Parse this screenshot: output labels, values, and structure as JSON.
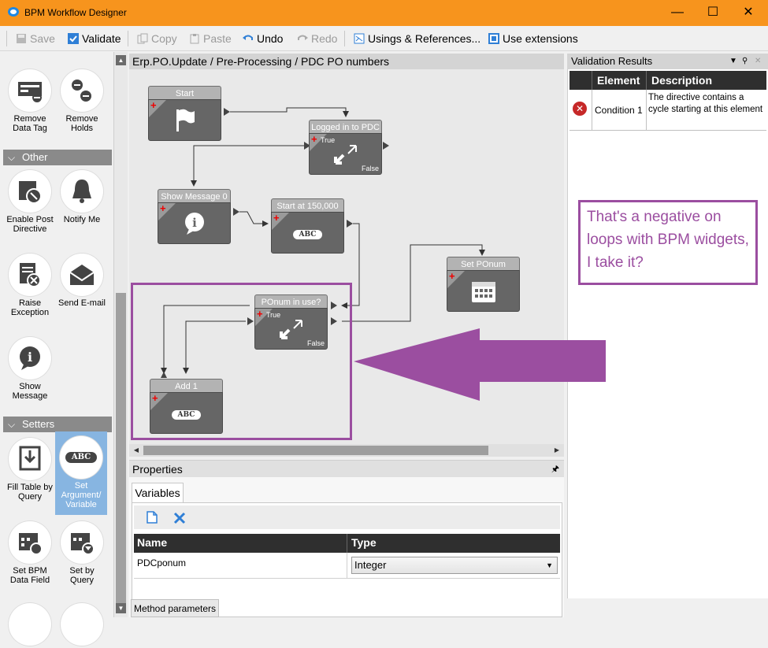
{
  "window": {
    "title": "BPM Workflow Designer"
  },
  "toolbar": {
    "save": "Save",
    "validate": "Validate",
    "copy": "Copy",
    "paste": "Paste",
    "undo": "Undo",
    "redo": "Redo",
    "usings": "Usings & References...",
    "extensions": "Use extensions"
  },
  "toolbox": {
    "top_items": [
      "Remove Data Tag",
      "Remove Holds"
    ],
    "group_other": "Other",
    "other_items": [
      "Enable Post Directive",
      "Notify Me",
      "Raise Exception",
      "Send E-mail",
      "Show Message"
    ],
    "group_setters": "Setters",
    "setter_items": [
      "Fill Table by Query",
      "Set Argument/ Variable",
      "Set BPM Data Field",
      "Set by Query"
    ]
  },
  "canvas": {
    "breadcrumb": "Erp.PO.Update / Pre-Processing / PDC PO numbers",
    "nodes": {
      "start": "Start",
      "logged_in": "Logged in to PDC",
      "show_message": "Show Message 0",
      "start_at": "Start at 150,000",
      "set_ponum": "Set POnum",
      "ponum_in_use": "POnum in use?",
      "add_one": "Add 1"
    },
    "true_label": "True",
    "false_label": "False",
    "abc_label": "ABC"
  },
  "properties": {
    "title": "Properties",
    "tab": "Variables",
    "columns": [
      "Name",
      "Type"
    ],
    "rows": [
      {
        "name": "PDCponum",
        "type": "Integer"
      }
    ],
    "method_tab": "Method parameters"
  },
  "validation": {
    "title": "Validation Results",
    "columns": [
      "Element",
      "Description"
    ],
    "rows": [
      {
        "element": "Condition 1",
        "description": "The directive contains a cycle starting at this element"
      }
    ]
  },
  "annotation": {
    "text": "That's a negative on loops with BPM widgets, I take it?",
    "color": "#9b4ea0"
  },
  "colors": {
    "titlebar": "#f7941d",
    "accent": "#1e88e5"
  }
}
